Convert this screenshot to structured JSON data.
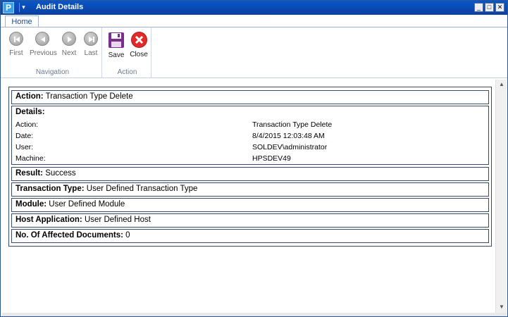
{
  "window": {
    "title": "Audit Details",
    "app_icon_glyph": "P",
    "qat_glyph": "▾",
    "controls": {
      "minimize": "_",
      "maximize": "□",
      "close": "✕"
    }
  },
  "ribbon": {
    "tabs": [
      {
        "label": "Home",
        "selected": true
      }
    ],
    "groups": {
      "navigation": {
        "label": "Navigation",
        "buttons": [
          {
            "label": "First",
            "icon": "skip-first-icon",
            "enabled": false
          },
          {
            "label": "Previous",
            "icon": "previous-icon",
            "enabled": false
          },
          {
            "label": "Next",
            "icon": "next-icon",
            "enabled": false
          },
          {
            "label": "Last",
            "icon": "skip-last-icon",
            "enabled": false
          }
        ]
      },
      "action": {
        "label": "Action",
        "buttons": [
          {
            "label": "Save",
            "icon": "floppy-disk-icon",
            "color": "#7b2d8e"
          },
          {
            "label": "Close",
            "icon": "close-icon",
            "color": "#e32a2a"
          }
        ]
      }
    }
  },
  "audit": {
    "action": {
      "label": "Action:",
      "value": "Transaction Type Delete"
    },
    "details": {
      "label": "Details:",
      "rows": [
        {
          "key": "Action:",
          "value": "Transaction Type Delete"
        },
        {
          "key": "Date:",
          "value": "8/4/2015 12:03:48 AM"
        },
        {
          "key": "User:",
          "value": "SOLDEV\\administrator"
        },
        {
          "key": "Machine:",
          "value": "HPSDEV49"
        }
      ]
    },
    "result": {
      "label": "Result:",
      "value": "Success"
    },
    "transaction_type": {
      "label": "Transaction Type:",
      "value": "User Defined Transaction Type"
    },
    "module": {
      "label": "Module:",
      "value": "User Defined Module"
    },
    "host_application": {
      "label": "Host Application:",
      "value": "User Defined Host"
    },
    "affected_documents": {
      "label": "No. Of Affected Documents:",
      "value": "0"
    }
  },
  "scrollbar": {
    "up_glyph": "▲",
    "down_glyph": "▼"
  },
  "colors": {
    "titlebar": "#0b3fa3",
    "border": "#3a4a62",
    "save": "#7b2d8e",
    "close": "#e32a2a"
  }
}
